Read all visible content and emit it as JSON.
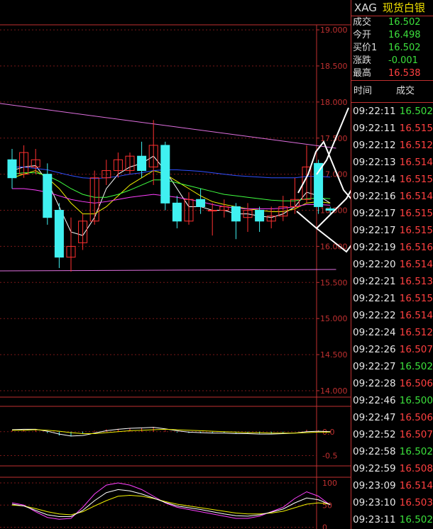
{
  "header": {
    "symbol": "XAG",
    "name": "现货白银"
  },
  "quote": [
    {
      "label": "成交",
      "value": "16.502",
      "color": "green"
    },
    {
      "label": "今开",
      "value": "16.498",
      "color": "green"
    },
    {
      "label": "买价1",
      "value": "16.502",
      "color": "green"
    },
    {
      "label": "涨跌",
      "value": "-0.001",
      "color": "green"
    },
    {
      "label": "最高",
      "value": "16.538",
      "color": "red"
    }
  ],
  "ticks_header": {
    "time": "时间",
    "price": "成交"
  },
  "ticks": [
    {
      "time": "09:22:11",
      "price": "16.502",
      "color": "green"
    },
    {
      "time": "09:22:11",
      "price": "16.515",
      "color": "red"
    },
    {
      "time": "09:22:12",
      "price": "16.512",
      "color": "red"
    },
    {
      "time": "09:22:13",
      "price": "16.514",
      "color": "red"
    },
    {
      "time": "09:22:14",
      "price": "16.515",
      "color": "red"
    },
    {
      "time": "09:22:16",
      "price": "16.514",
      "color": "red"
    },
    {
      "time": "09:22:17",
      "price": "16.515",
      "color": "red"
    },
    {
      "time": "09:22:17",
      "price": "16.515",
      "color": "red"
    },
    {
      "time": "09:22:19",
      "price": "16.516",
      "color": "red"
    },
    {
      "time": "09:22:20",
      "price": "16.514",
      "color": "red"
    },
    {
      "time": "09:22:21",
      "price": "16.513",
      "color": "red"
    },
    {
      "time": "09:22:21",
      "price": "16.515",
      "color": "red"
    },
    {
      "time": "09:22:22",
      "price": "16.514",
      "color": "red"
    },
    {
      "time": "09:22:24",
      "price": "16.512",
      "color": "red"
    },
    {
      "time": "09:22:26",
      "price": "16.507",
      "color": "red"
    },
    {
      "time": "09:22:27",
      "price": "16.502",
      "color": "green"
    },
    {
      "time": "09:22:28",
      "price": "16.506",
      "color": "red"
    },
    {
      "time": "09:22:46",
      "price": "16.500",
      "color": "green"
    },
    {
      "time": "09:22:47",
      "price": "16.506",
      "color": "red"
    },
    {
      "time": "09:22:52",
      "price": "16.507",
      "color": "red"
    },
    {
      "time": "09:22:58",
      "price": "16.502",
      "color": "green"
    },
    {
      "time": "09:22:59",
      "price": "16.508",
      "color": "red"
    },
    {
      "time": "09:23:09",
      "price": "16.514",
      "color": "red"
    },
    {
      "time": "09:23:10",
      "price": "16.503",
      "color": "red"
    },
    {
      "time": "09:23:11",
      "price": "16.502",
      "color": "green"
    }
  ],
  "chart_data": [
    {
      "type": "candlestick",
      "y_ticks": [
        "19.000",
        "18.500",
        "18.000",
        "17.500",
        "17.000",
        "16.500",
        "16.000",
        "15.500",
        "15.000",
        "14.500",
        "14.000"
      ],
      "ylim": [
        13.98,
        19.05
      ],
      "candles": [
        {
          "o": 17.2,
          "c": 16.95,
          "h": 17.35,
          "l": 16.8
        },
        {
          "o": 17.0,
          "c": 17.3,
          "h": 17.4,
          "l": 16.95
        },
        {
          "o": 17.1,
          "c": 17.2,
          "h": 17.35,
          "l": 17.0
        },
        {
          "o": 17.0,
          "c": 16.4,
          "h": 17.15,
          "l": 16.3
        },
        {
          "o": 16.5,
          "c": 15.85,
          "h": 16.6,
          "l": 15.7
        },
        {
          "o": 15.85,
          "c": 16.0,
          "h": 16.4,
          "l": 15.65
        },
        {
          "o": 16.05,
          "c": 16.35,
          "h": 16.45,
          "l": 15.95
        },
        {
          "o": 16.35,
          "c": 16.95,
          "h": 17.05,
          "l": 16.3
        },
        {
          "o": 16.95,
          "c": 17.05,
          "h": 17.2,
          "l": 16.85
        },
        {
          "o": 17.05,
          "c": 17.2,
          "h": 17.3,
          "l": 16.95
        },
        {
          "o": 17.05,
          "c": 17.25,
          "h": 17.3,
          "l": 17.0
        },
        {
          "o": 17.25,
          "c": 17.05,
          "h": 17.45,
          "l": 16.95
        },
        {
          "o": 17.1,
          "c": 17.4,
          "h": 17.75,
          "l": 16.85
        },
        {
          "o": 17.4,
          "c": 16.6,
          "h": 17.45,
          "l": 16.5
        },
        {
          "o": 16.6,
          "c": 16.35,
          "h": 16.7,
          "l": 16.25
        },
        {
          "o": 16.35,
          "c": 16.65,
          "h": 16.75,
          "l": 16.3
        },
        {
          "o": 16.65,
          "c": 16.55,
          "h": 16.8,
          "l": 16.45
        },
        {
          "o": 16.5,
          "c": 16.5,
          "h": 16.6,
          "l": 16.15
        },
        {
          "o": 16.5,
          "c": 16.55,
          "h": 16.65,
          "l": 16.4
        },
        {
          "o": 16.55,
          "c": 16.35,
          "h": 16.6,
          "l": 16.1
        },
        {
          "o": 16.4,
          "c": 16.5,
          "h": 16.6,
          "l": 16.2
        },
        {
          "o": 16.5,
          "c": 16.35,
          "h": 16.55,
          "l": 16.2
        },
        {
          "o": 16.35,
          "c": 16.42,
          "h": 16.55,
          "l": 16.25
        },
        {
          "o": 16.42,
          "c": 16.55,
          "h": 16.7,
          "l": 16.35
        },
        {
          "o": 16.55,
          "c": 16.65,
          "h": 16.95,
          "l": 16.45
        },
        {
          "o": 16.65,
          "c": 17.1,
          "h": 17.4,
          "l": 16.6
        },
        {
          "o": 17.15,
          "c": 16.55,
          "h": 17.2,
          "l": 16.45
        },
        {
          "o": 16.52,
          "c": 16.5,
          "h": 16.55,
          "l": 16.45
        }
      ],
      "ma_lines": [
        {
          "color": "#ffffff",
          "values": [
            17.05,
            17.1,
            17.12,
            16.9,
            16.55,
            16.2,
            16.15,
            16.4,
            16.8,
            17.0,
            17.1,
            17.15,
            17.25,
            17.05,
            16.8,
            16.55,
            16.55,
            16.5,
            16.5,
            16.45,
            16.45,
            16.42,
            16.4,
            16.45,
            16.55,
            16.75,
            16.7,
            16.6
          ]
        },
        {
          "color": "#f0f000",
          "values": [
            16.95,
            17.0,
            17.05,
            16.95,
            16.8,
            16.6,
            16.45,
            16.45,
            16.55,
            16.7,
            16.85,
            16.95,
            17.05,
            17.0,
            16.9,
            16.8,
            16.7,
            16.62,
            16.58,
            16.55,
            16.52,
            16.5,
            16.48,
            16.48,
            16.52,
            16.6,
            16.62,
            16.6
          ]
        },
        {
          "color": "#40ff40",
          "values": [
            17.0,
            17.02,
            17.02,
            16.98,
            16.9,
            16.8,
            16.72,
            16.68,
            16.68,
            16.72,
            16.78,
            16.85,
            16.92,
            16.92,
            16.88,
            16.84,
            16.8,
            16.76,
            16.72,
            16.7,
            16.68,
            16.66,
            16.64,
            16.63,
            16.63,
            16.66,
            16.67,
            16.66
          ]
        },
        {
          "color": "#3050ff",
          "values": [
            17.1,
            17.1,
            17.08,
            17.06,
            17.02,
            16.98,
            16.95,
            16.94,
            16.95,
            16.97,
            17.0,
            17.02,
            17.05,
            17.06,
            17.06,
            17.05,
            17.04,
            17.02,
            17.0,
            16.98,
            16.97,
            16.96,
            16.95,
            16.95,
            16.95,
            16.97,
            16.97,
            16.96
          ]
        },
        {
          "color": "#ff40ff",
          "values": [
            16.8,
            16.8,
            16.78,
            16.75,
            16.7,
            16.65,
            16.62,
            16.6,
            16.62,
            16.65,
            16.68,
            16.7,
            16.72,
            16.7,
            16.68,
            16.65,
            16.62,
            16.58,
            16.55,
            16.53,
            16.52,
            16.52,
            16.52,
            16.53,
            16.55,
            16.58,
            16.58,
            16.57
          ]
        }
      ],
      "trendlines": [
        {
          "color": "#e070e0",
          "from": [
            0,
            17.98
          ],
          "to": [
            27.5,
            17.36
          ]
        },
        {
          "color": "#e070e0",
          "from": [
            0,
            15.66
          ],
          "to": [
            27.5,
            15.68
          ]
        }
      ]
    },
    {
      "type": "bar",
      "y_ticks": [
        "0.0",
        "-0.5"
      ],
      "ylim": [
        -0.7,
        0.5
      ],
      "values": [
        0.02,
        0.04,
        0.03,
        -0.03,
        -0.08,
        -0.1,
        -0.05,
        0.02,
        0.05,
        0.06,
        0.07,
        0.08,
        0.1,
        0.03,
        -0.02,
        -0.03,
        -0.03,
        -0.03,
        -0.02,
        -0.03,
        -0.03,
        -0.04,
        -0.04,
        -0.02,
        0.0,
        0.04,
        0.03,
        0.01
      ],
      "dif": [
        0.04,
        0.05,
        0.05,
        0.01,
        -0.05,
        -0.09,
        -0.08,
        -0.03,
        0.02,
        0.05,
        0.07,
        0.08,
        0.09,
        0.06,
        0.02,
        -0.01,
        -0.02,
        -0.03,
        -0.03,
        -0.04,
        -0.04,
        -0.05,
        -0.05,
        -0.04,
        -0.03,
        0.0,
        0.01,
        0.0
      ],
      "dea": [
        0.03,
        0.03,
        0.04,
        0.03,
        0.01,
        -0.02,
        -0.04,
        -0.04,
        -0.02,
        0.0,
        0.02,
        0.03,
        0.04,
        0.05,
        0.04,
        0.03,
        0.02,
        0.01,
        0.0,
        -0.01,
        -0.02,
        -0.02,
        -0.03,
        -0.03,
        -0.03,
        -0.02,
        -0.01,
        -0.01
      ]
    },
    {
      "type": "line",
      "y_ticks": [
        "100",
        "50",
        "0"
      ],
      "ylim": [
        -4,
        108
      ],
      "series": [
        {
          "color": "#ff40ff",
          "values": [
            55,
            50,
            35,
            22,
            18,
            20,
            45,
            75,
            95,
            100,
            95,
            85,
            70,
            55,
            45,
            40,
            35,
            30,
            25,
            20,
            20,
            25,
            35,
            45,
            65,
            80,
            70,
            50
          ]
        },
        {
          "color": "#f0f000",
          "values": [
            50,
            48,
            42,
            35,
            30,
            28,
            35,
            48,
            60,
            70,
            72,
            70,
            65,
            58,
            52,
            48,
            44,
            40,
            36,
            32,
            30,
            30,
            32,
            36,
            44,
            52,
            55,
            52
          ]
        },
        {
          "color": "#ffffff",
          "values": [
            52,
            48,
            38,
            28,
            24,
            24,
            38,
            60,
            78,
            85,
            82,
            75,
            66,
            56,
            48,
            44,
            40,
            35,
            30,
            26,
            25,
            28,
            34,
            41,
            55,
            66,
            62,
            51
          ]
        }
      ]
    }
  ]
}
